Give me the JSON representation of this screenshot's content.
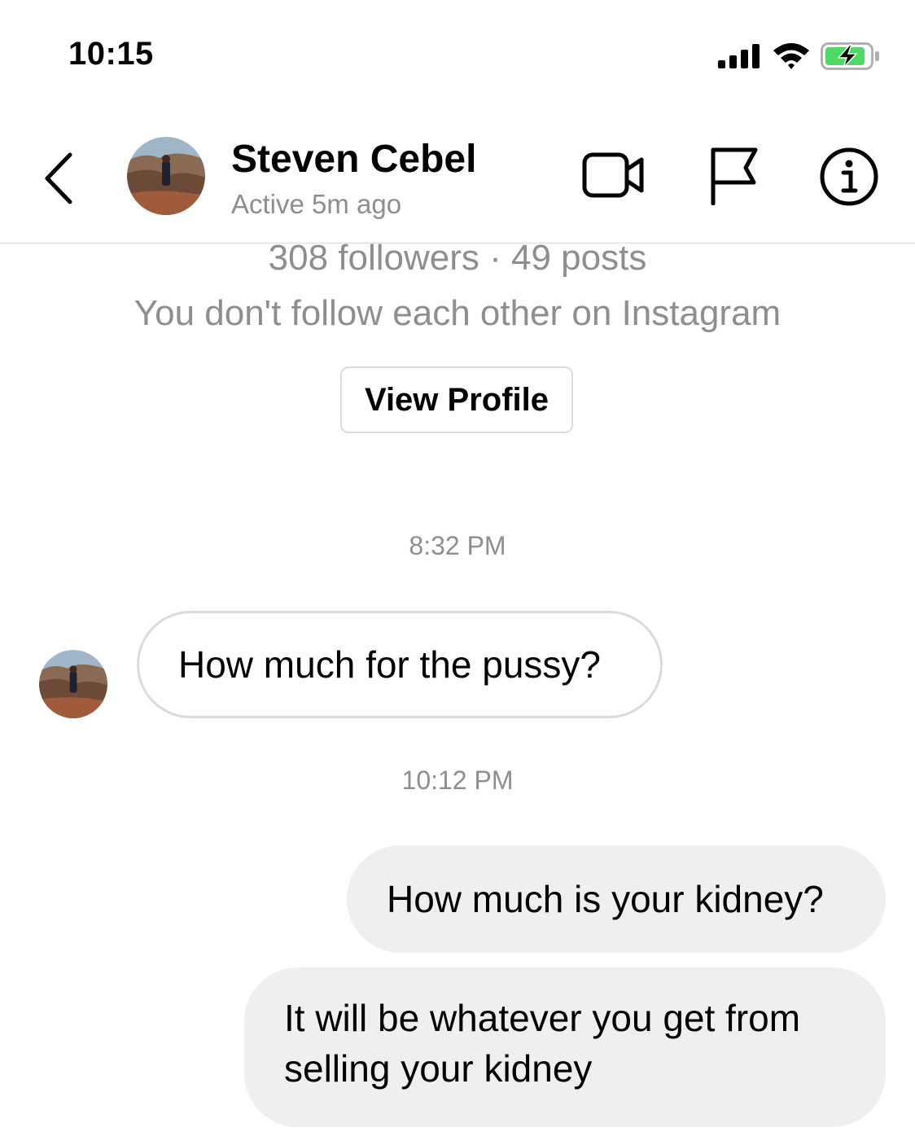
{
  "status_bar": {
    "time": "10:15",
    "icons": [
      "cellular-signal-icon",
      "wifi-icon",
      "battery-charging-icon"
    ],
    "battery_color": "#4cd964"
  },
  "header": {
    "name": "Steven Cebel",
    "status": "Active 5m ago",
    "actions": [
      "back-chevron-icon",
      "video-camera-icon",
      "flag-icon",
      "info-icon"
    ]
  },
  "profile": {
    "stats": "308 followers · 49 posts",
    "follow_note": "You don't follow each other on Instagram",
    "view_profile_label": "View Profile"
  },
  "messages": [
    {
      "type": "timestamp",
      "text": "8:32 PM"
    },
    {
      "type": "received",
      "text": "How much for the pussy?"
    },
    {
      "type": "timestamp",
      "text": "10:12 PM"
    },
    {
      "type": "sent",
      "text": "How much is your kidney?"
    },
    {
      "type": "sent",
      "text": "It will be whatever you get from selling your kidney"
    }
  ],
  "colors": {
    "secondary_text": "#8e8e8e",
    "sent_bubble": "#efefef",
    "received_border": "#dbdbdb"
  }
}
